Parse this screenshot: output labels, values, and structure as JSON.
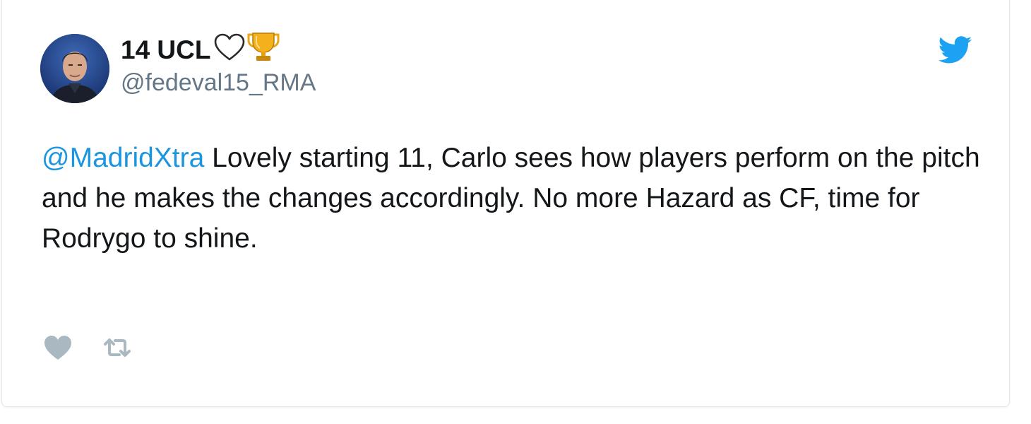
{
  "tweet": {
    "author": {
      "display_name": "14 UCL",
      "name_emojis": [
        "white-heart-icon",
        "trophy-icon"
      ],
      "username": "@fedeval15_RMA"
    },
    "mention": "@MadridXtra",
    "text": " Lovely starting 11, Carlo sees how players perform on the pitch and he makes the changes accordingly. No more Hazard as CF, time for Rodrygo to shine.",
    "actions": [
      "heart-icon",
      "retweet-icon"
    ]
  },
  "colors": {
    "twitter_blue": "#1da1f2",
    "mention": "#1b95e0",
    "text": "#14171a",
    "secondary_text": "#657786",
    "action_icons": "#aab8c2",
    "border": "#e1e8ed"
  },
  "brand_icon": "twitter-bird-icon"
}
